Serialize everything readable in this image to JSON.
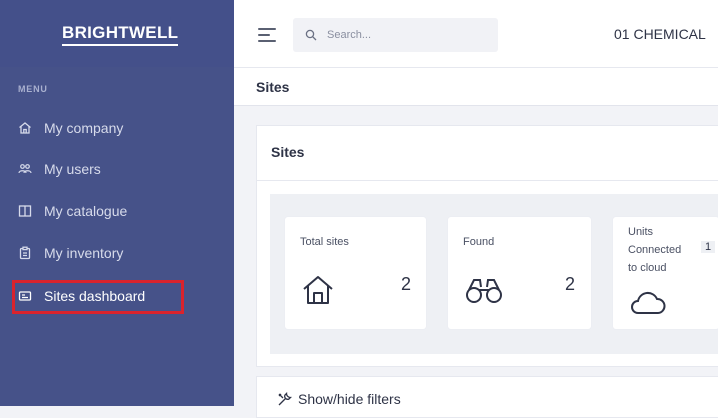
{
  "brand": {
    "name": "BRIGHTWELL"
  },
  "sidebar": {
    "menu_heading": "MENU",
    "items": [
      {
        "label": "My company",
        "icon": "home-icon"
      },
      {
        "label": "My users",
        "icon": "users-icon"
      },
      {
        "label": "My catalogue",
        "icon": "book-icon"
      },
      {
        "label": "My inventory",
        "icon": "clipboard-icon"
      },
      {
        "label": "Sites dashboard",
        "icon": "dashboard-icon",
        "active": true
      }
    ]
  },
  "topbar": {
    "search_placeholder": "Search...",
    "company_name": "01 CHEMICAL"
  },
  "breadcrumb": {
    "current": "Sites"
  },
  "card": {
    "title": "Sites",
    "stats": [
      {
        "label": "Total sites",
        "value": "2",
        "icon": "house-icon"
      },
      {
        "label": "Found",
        "value": "2",
        "icon": "binoculars-icon"
      },
      {
        "label": "Units Connected to cloud",
        "label_lines": [
          "Units",
          "Connected",
          "to cloud"
        ],
        "value": "1",
        "icon": "cloud-icon"
      }
    ]
  },
  "filters": {
    "toggle_label": "Show/hide filters"
  },
  "colors": {
    "sidebar_bg": "#465289",
    "highlight": "#d9232d",
    "page_bg": "#f2f3f7"
  }
}
